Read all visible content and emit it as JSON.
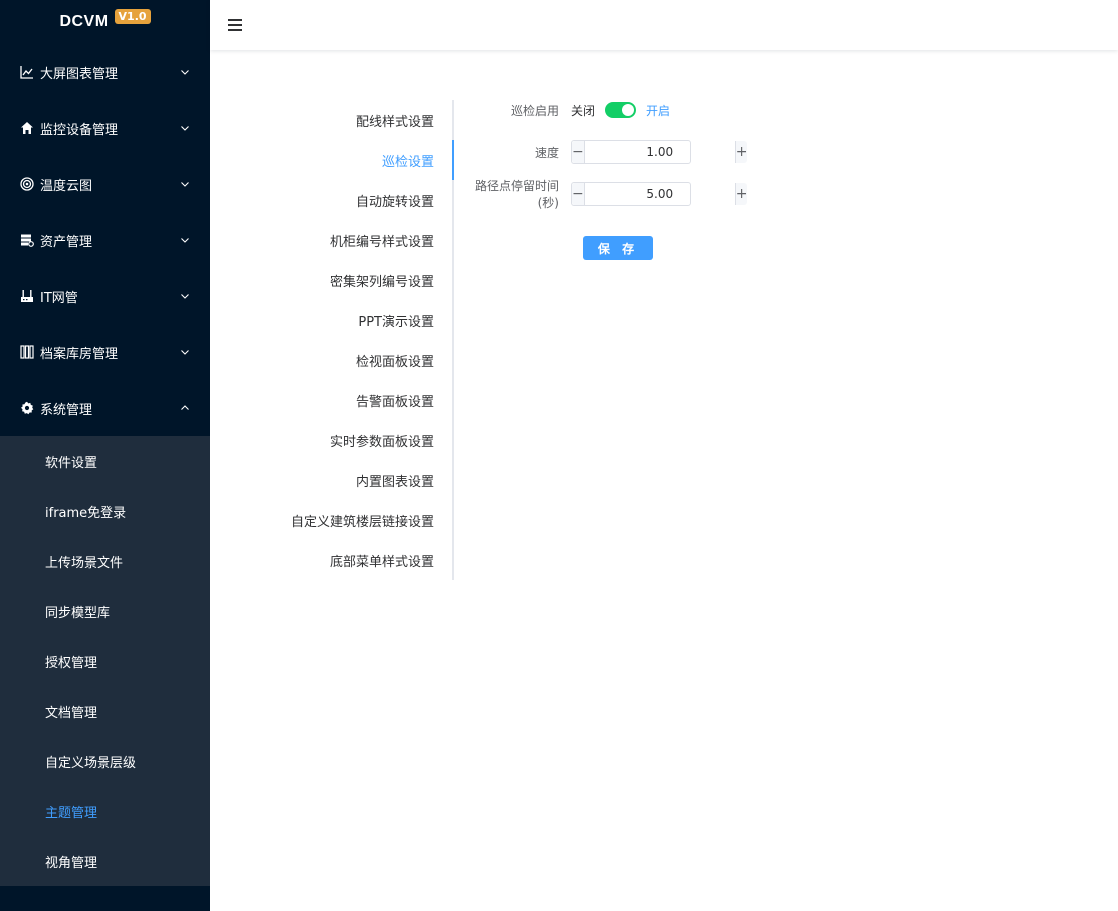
{
  "brand": {
    "name": "DCVM",
    "version": "V1.0"
  },
  "sidebar": {
    "items": [
      {
        "label": "大屏图表管理",
        "icon": "line-chart-icon"
      },
      {
        "label": "监控设备管理",
        "icon": "home-icon"
      },
      {
        "label": "温度云图",
        "icon": "target-icon"
      },
      {
        "label": "资产管理",
        "icon": "server-icon"
      },
      {
        "label": "IT网管",
        "icon": "router-icon"
      },
      {
        "label": "档案库房管理",
        "icon": "archive-icon"
      },
      {
        "label": "系统管理",
        "icon": "gear-icon",
        "expanded": true
      }
    ],
    "subitems": [
      {
        "label": "软件设置"
      },
      {
        "label": "iframe免登录"
      },
      {
        "label": "上传场景文件"
      },
      {
        "label": "同步模型库"
      },
      {
        "label": "授权管理"
      },
      {
        "label": "文档管理"
      },
      {
        "label": "自定义场景层级"
      },
      {
        "label": "主题管理",
        "active": true
      },
      {
        "label": "视角管理"
      }
    ]
  },
  "tabs": [
    "配线样式设置",
    "巡检设置",
    "自动旋转设置",
    "机柜编号样式设置",
    "密集架列编号设置",
    "PPT演示设置",
    "检视面板设置",
    "告警面板设置",
    "实时参数面板设置",
    "内置图表设置",
    "自定义建筑楼层链接设置",
    "底部菜单样式设置"
  ],
  "active_tab": "巡检设置",
  "form": {
    "enable_label": "巡检启用",
    "off_text": "关闭",
    "on_text": "开启",
    "enabled": true,
    "speed_label": "速度",
    "speed_value": "1.00",
    "dwell_label": "路径点停留时间(秒)",
    "dwell_value": "5.00",
    "save_label": "保 存"
  },
  "colors": {
    "sidebar_bg": "#001529",
    "submenu_bg": "#1f2d3d",
    "accent": "#409eff",
    "switch_on": "#13ce66",
    "badge": "#e6a23c"
  }
}
